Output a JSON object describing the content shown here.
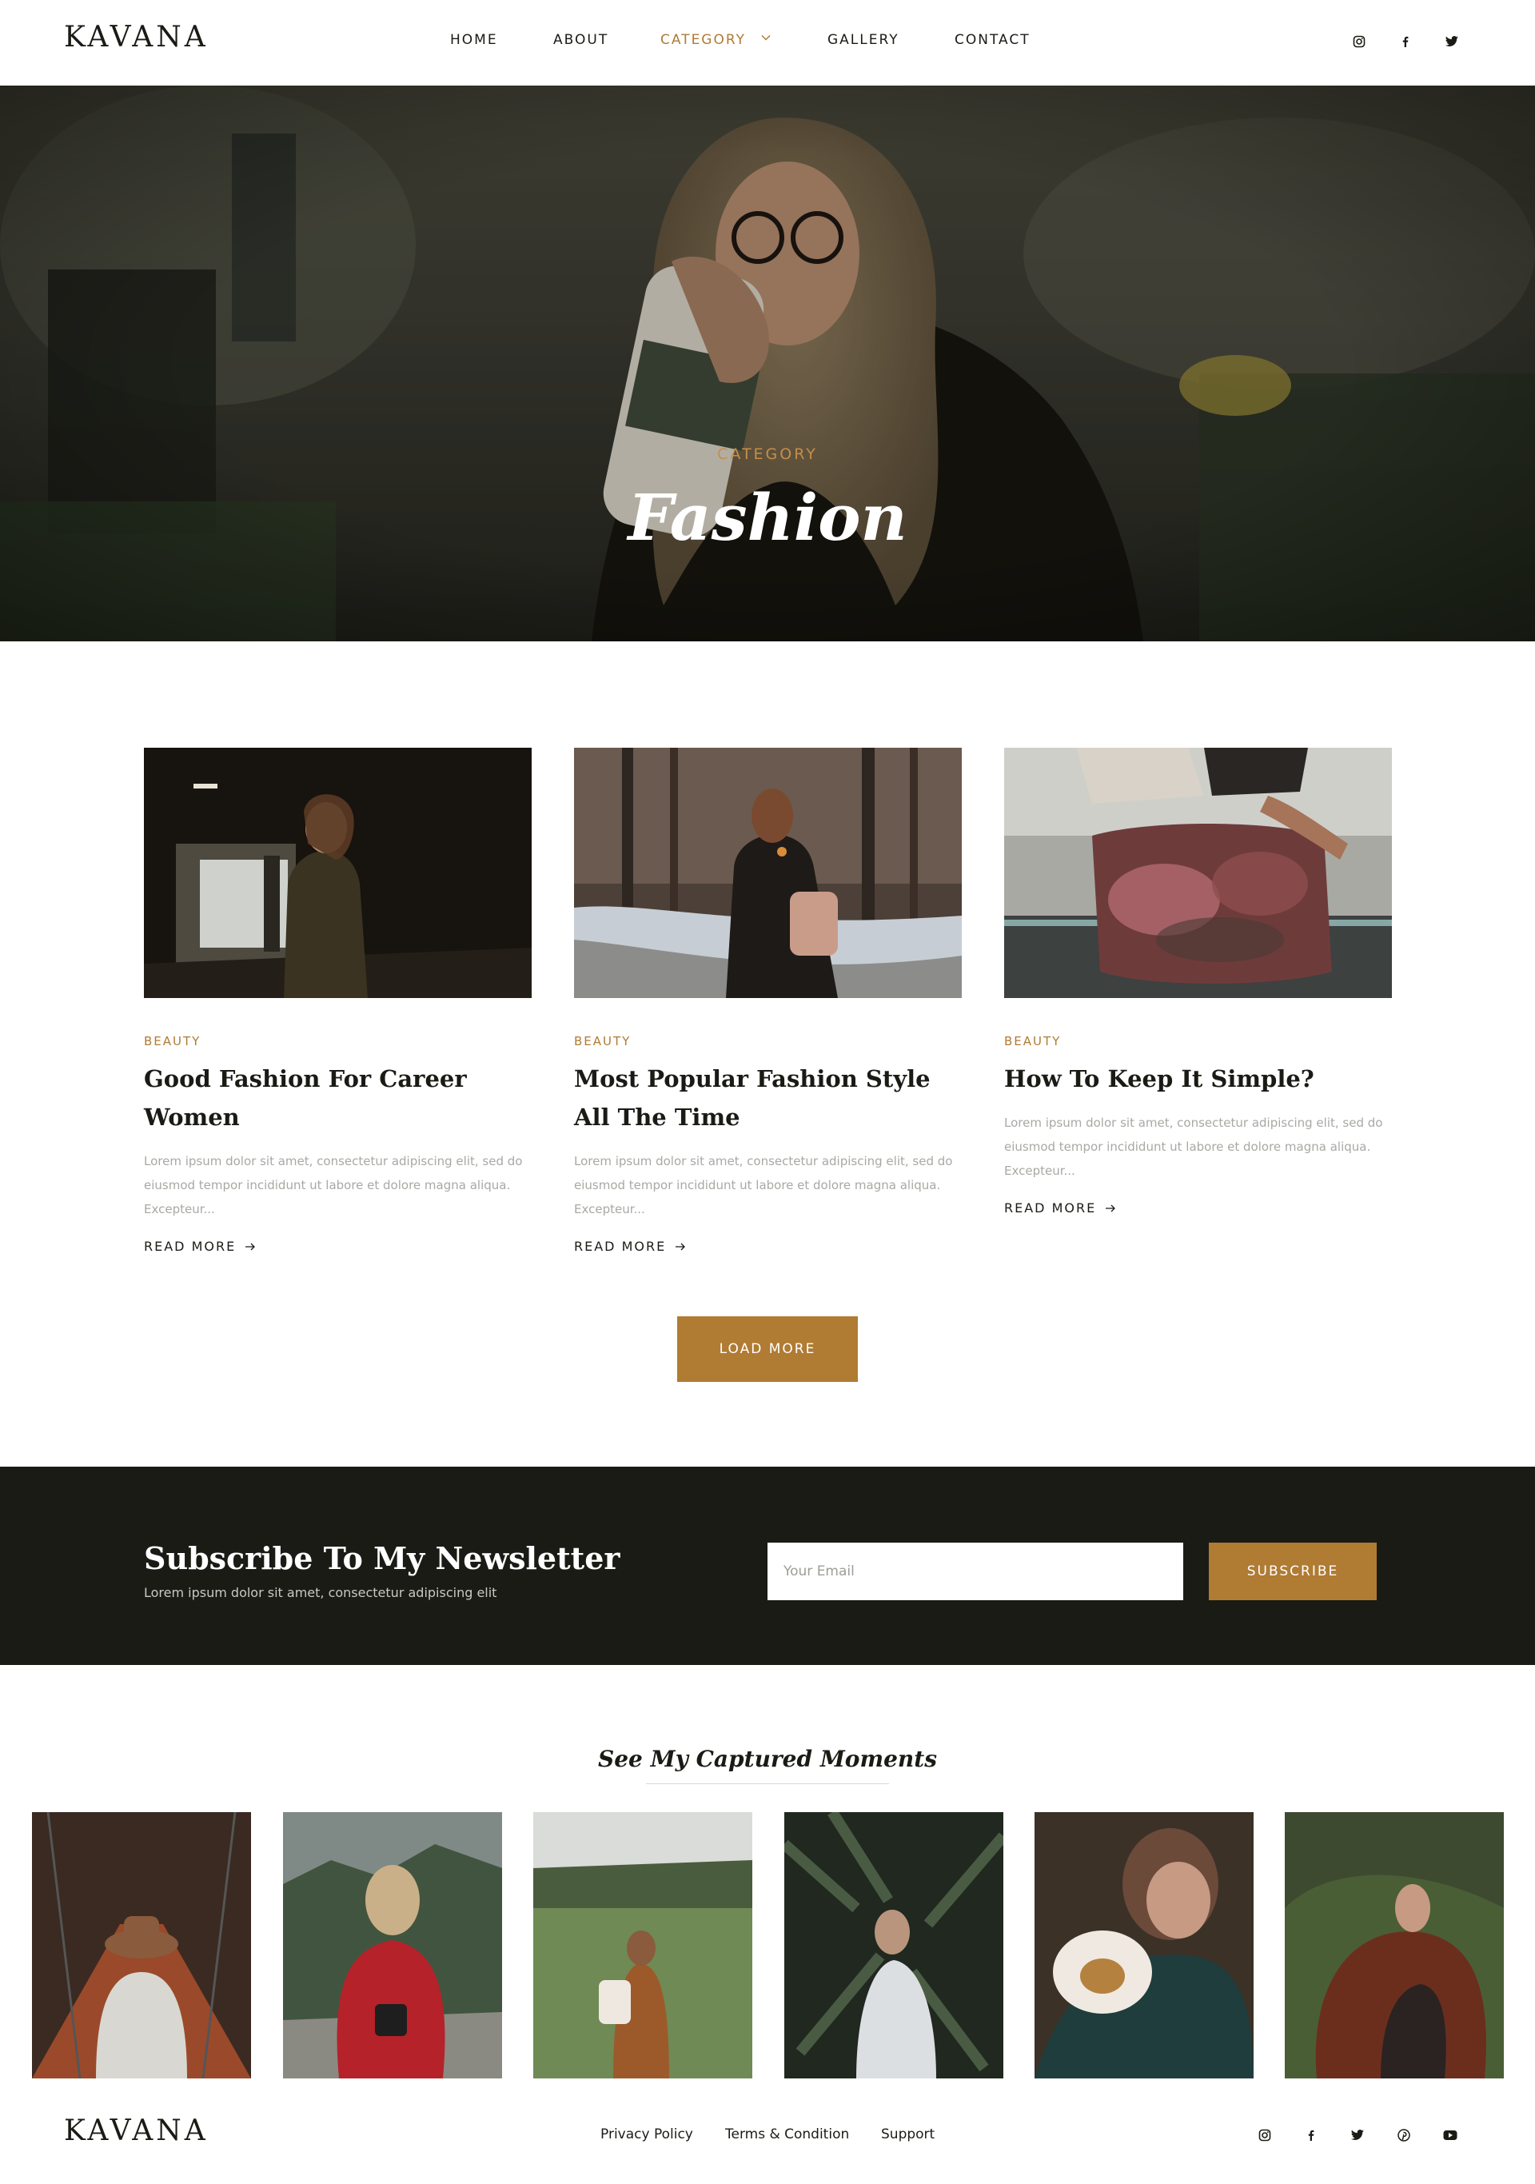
{
  "header": {
    "logo": "KAVANA",
    "nav": [
      {
        "label": "HOME"
      },
      {
        "label": "ABOUT"
      },
      {
        "label": "CATEGORY",
        "active": true
      },
      {
        "label": "GALLERY"
      },
      {
        "label": "CONTACT"
      }
    ],
    "social": [
      "instagram-icon",
      "facebook-icon",
      "twitter-icon"
    ]
  },
  "hero": {
    "eyebrow": "CATEGORY",
    "title": "Fashion"
  },
  "posts": [
    {
      "category": "BEAUTY",
      "title": "Good Fashion For Career Women",
      "excerpt": "Lorem ipsum dolor sit amet, consectetur adipiscing elit, sed do eiusmod tempor incididunt ut labore et dolore magna aliqua. Excepteur...",
      "read_more": "READ MORE"
    },
    {
      "category": "BEAUTY",
      "title": "Most Popular Fashion Style All The Time",
      "excerpt": "Lorem ipsum dolor sit amet, consectetur adipiscing elit, sed do eiusmod tempor incididunt ut labore et dolore magna aliqua. Excepteur...",
      "read_more": "READ MORE"
    },
    {
      "category": "BEAUTY",
      "title": "How To Keep It Simple?",
      "excerpt": "Lorem ipsum dolor sit amet, consectetur adipiscing elit, sed do eiusmod tempor incididunt ut labore et dolore magna aliqua. Excepteur...",
      "read_more": "READ MORE"
    }
  ],
  "load_more": "LOAD MORE",
  "newsletter": {
    "title": "Subscribe To My Newsletter",
    "subtitle": "Lorem ipsum dolor sit amet, consectetur adipiscing elit",
    "email_placeholder": "Your Email",
    "email_value": "",
    "button": "SUBSCRIBE"
  },
  "moments": {
    "title": "See My Captured Moments"
  },
  "footer": {
    "logo": "KAVANA",
    "links": [
      "Privacy Policy",
      "Terms & Condition",
      "Support"
    ],
    "social": [
      "instagram-icon",
      "facebook-icon",
      "twitter-icon",
      "pinterest-icon",
      "youtube-icon"
    ]
  },
  "colors": {
    "accent": "#b07b33",
    "dark": "#1b1b16",
    "muted_text": "#a8a8a4"
  }
}
